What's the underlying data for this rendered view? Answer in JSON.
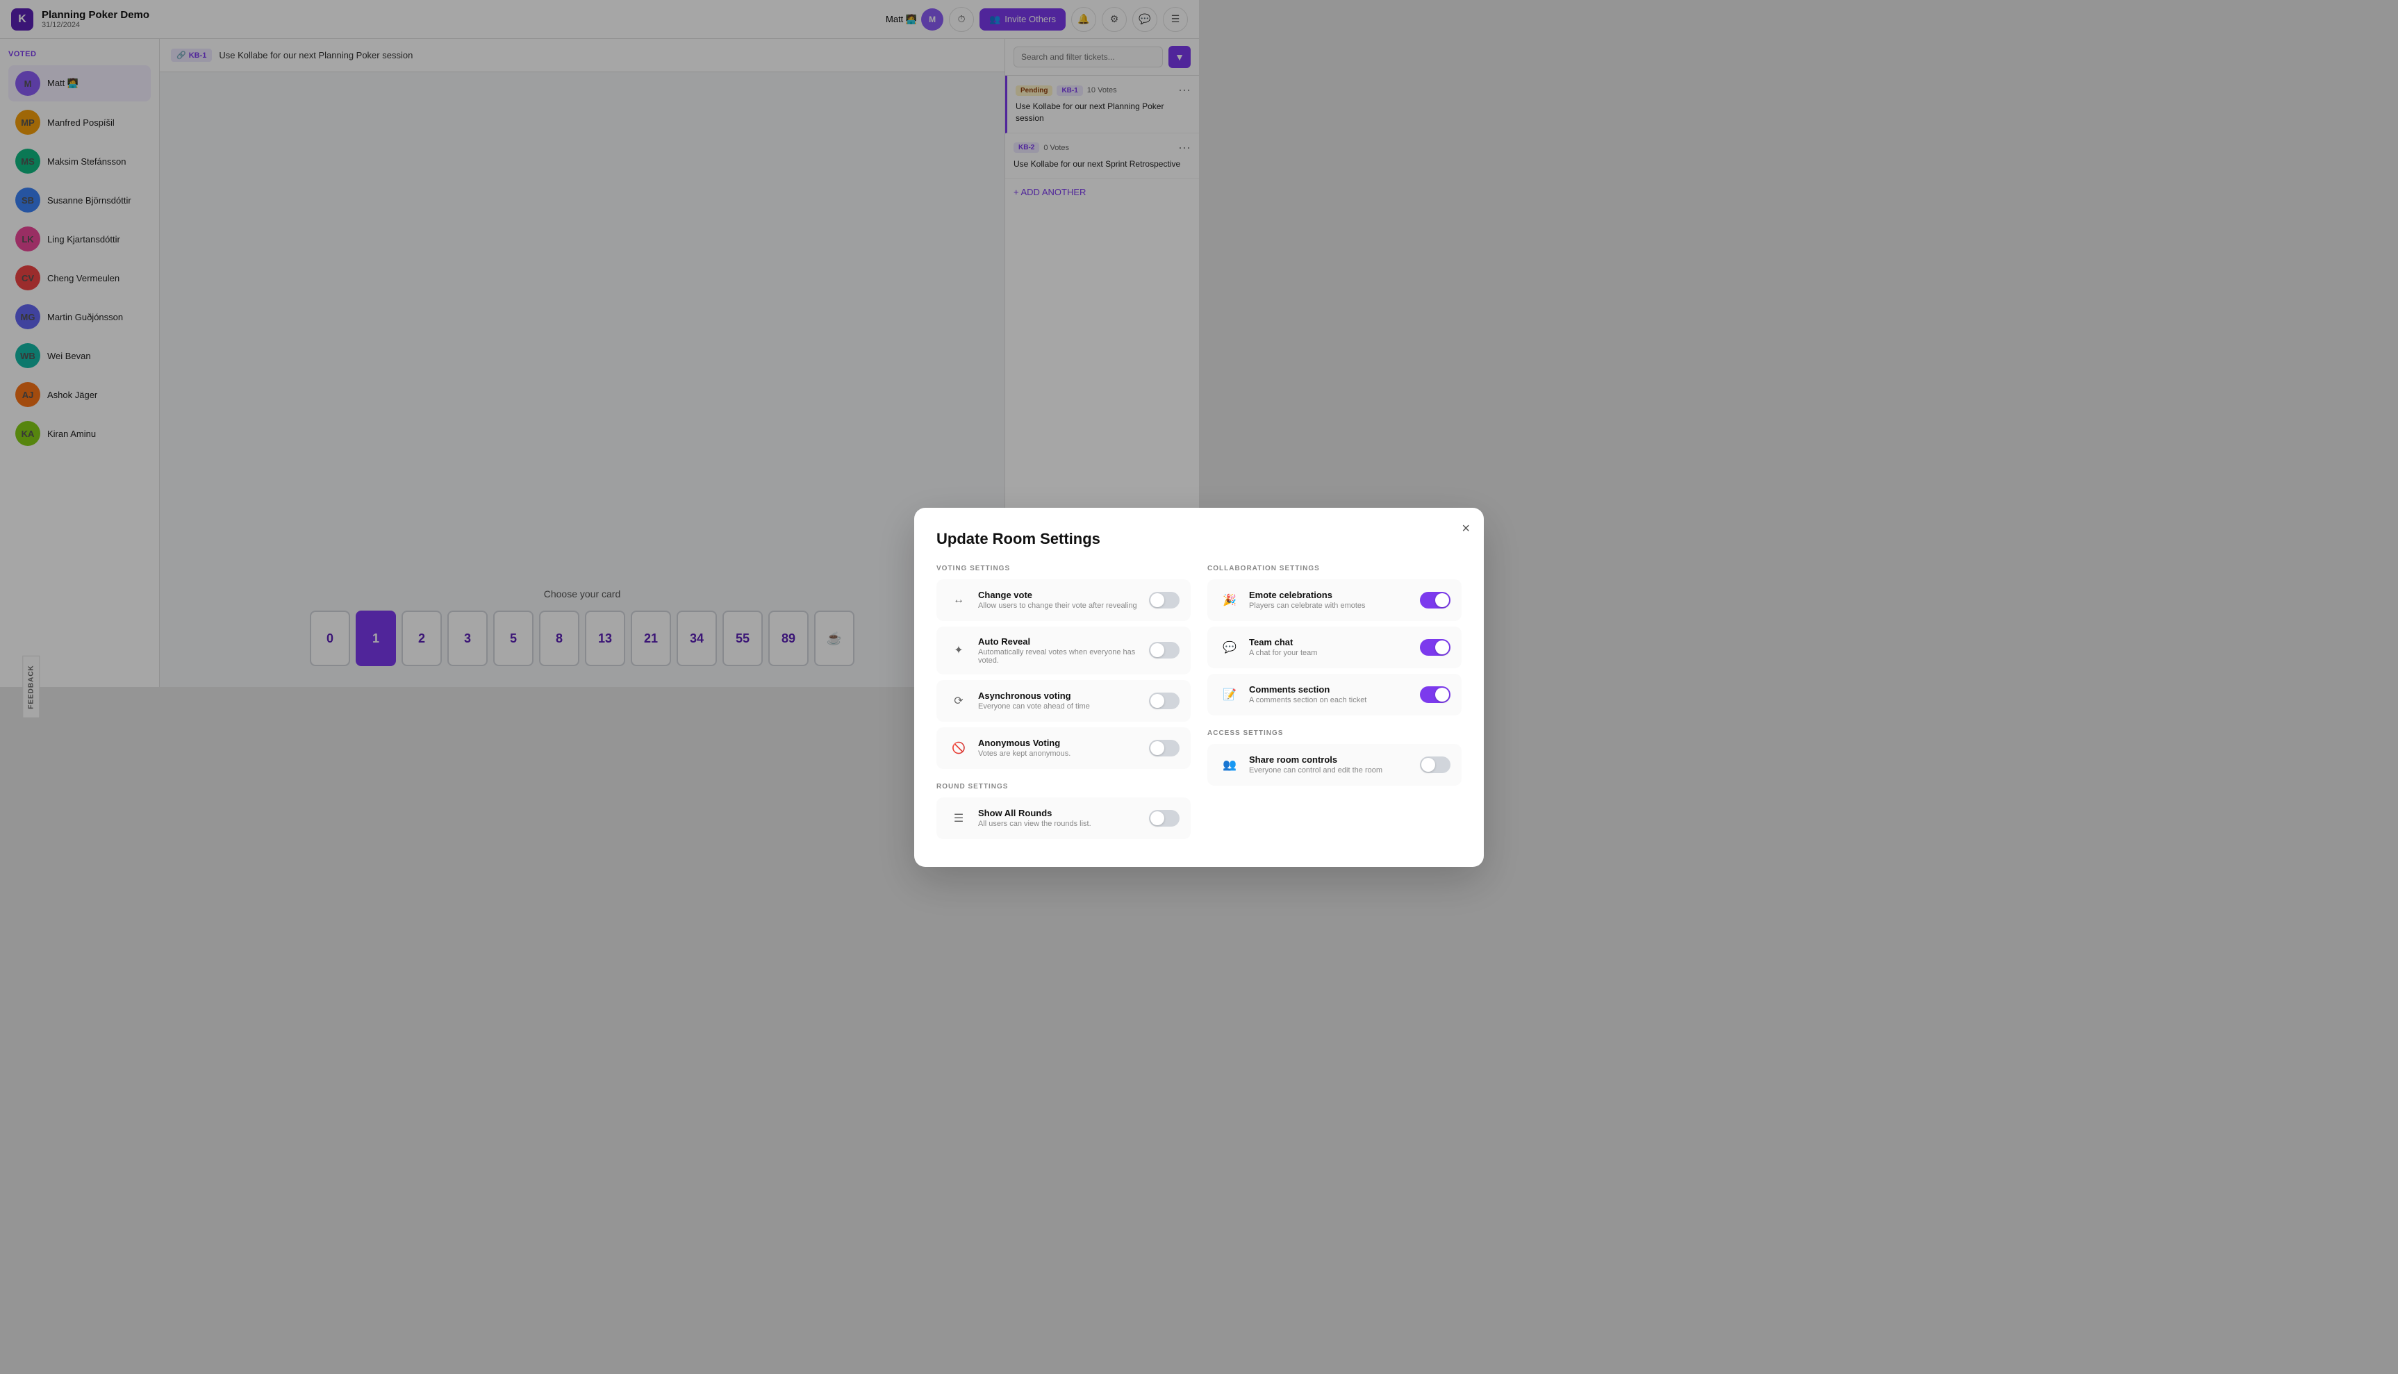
{
  "app": {
    "title": "Planning Poker Demo",
    "date": "31/12/2024",
    "logo": "K"
  },
  "header": {
    "user": "Matt 🧑‍💻",
    "invite_label": "Invite Others"
  },
  "sidebar": {
    "voted_label": "Voted",
    "users": [
      {
        "name": "Matt 🧑‍💻",
        "initials": "M",
        "color": "av1"
      },
      {
        "name": "Manfred Pospíšil",
        "initials": "MP",
        "color": "av2"
      },
      {
        "name": "Maksim Stefánsson",
        "initials": "MS",
        "color": "av3"
      },
      {
        "name": "Susanne Björnsdóttir",
        "initials": "SB",
        "color": "av4"
      },
      {
        "name": "Ling Kjartansdóttir",
        "initials": "LK",
        "color": "av5"
      },
      {
        "name": "Cheng Vermeulen",
        "initials": "CV",
        "color": "av6"
      },
      {
        "name": "Martin Guðjónsson",
        "initials": "MG",
        "color": "av7"
      },
      {
        "name": "Wei Bevan",
        "initials": "WB",
        "color": "av8"
      },
      {
        "name": "Ashok Jäger",
        "initials": "AJ",
        "color": "av9"
      },
      {
        "name": "Kiran Aminu",
        "initials": "KA",
        "color": "av10"
      }
    ]
  },
  "ticket_bar": {
    "badge": "KB-1",
    "title": "Use Kollabe for our next Planning Poker session"
  },
  "cards": {
    "choose_label": "Choose your card",
    "values": [
      "0",
      "1",
      "2",
      "3",
      "5",
      "8",
      "13",
      "21",
      "34",
      "55",
      "89",
      "☕"
    ]
  },
  "right_panel": {
    "search_placeholder": "Search and filter tickets...",
    "tickets": [
      {
        "status": "Pending",
        "badge": "KB-1",
        "votes": "10 Votes",
        "title": "Use Kollabe for our next Planning Poker session",
        "active": true
      },
      {
        "badge": "KB-2",
        "votes": "0 Votes",
        "title": "Use Kollabe for our next Sprint Retrospective",
        "active": false
      }
    ],
    "add_another": "+ ADD ANOTHER"
  },
  "modal": {
    "title": "Update Room Settings",
    "close_label": "×",
    "sections": {
      "voting": {
        "title": "VOTING SETTINGS",
        "items": [
          {
            "icon": "↔",
            "name": "Change vote",
            "desc": "Allow users to change their vote after revealing",
            "on": false
          },
          {
            "icon": "✦",
            "name": "Auto Reveal",
            "desc": "Automatically reveal votes when everyone has voted.",
            "on": false
          },
          {
            "icon": "⟳",
            "name": "Asynchronous voting",
            "desc": "Everyone can vote ahead of time",
            "on": false
          },
          {
            "icon": "🚫",
            "name": "Anonymous Voting",
            "desc": "Votes are kept anonymous.",
            "on": false
          }
        ]
      },
      "round": {
        "title": "ROUND SETTINGS",
        "items": [
          {
            "icon": "☰",
            "name": "Show All Rounds",
            "desc": "All users can view the rounds list.",
            "on": false
          }
        ]
      },
      "collaboration": {
        "title": "COLLABORATION SETTINGS",
        "items": [
          {
            "icon": "🎉",
            "name": "Emote celebrations",
            "desc": "Players can celebrate with emotes",
            "on": true
          },
          {
            "icon": "💬",
            "name": "Team chat",
            "desc": "A chat for your team",
            "on": true
          },
          {
            "icon": "📝",
            "name": "Comments section",
            "desc": "A comments section on each ticket",
            "on": true
          }
        ]
      },
      "access": {
        "title": "ACCESS SETTINGS",
        "items": [
          {
            "icon": "👥",
            "name": "Share room controls",
            "desc": "Everyone can control and edit the room",
            "on": false
          }
        ]
      }
    }
  },
  "feedback": {
    "label": "FEEDBACK"
  }
}
